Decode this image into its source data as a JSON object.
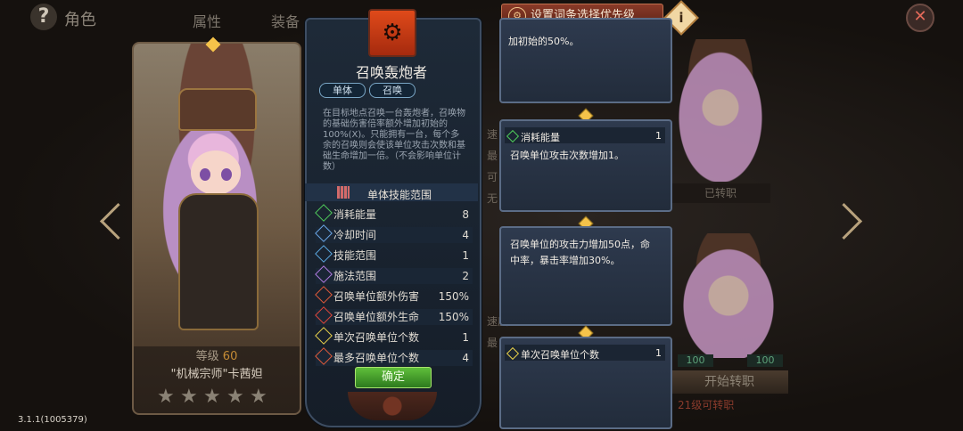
{
  "header": {
    "help_icon": "?",
    "title": "角色",
    "tabs": [
      "属性",
      "装备"
    ],
    "priority_button": "设置词条选择优先级",
    "info_icon": "i",
    "close_icon": "✕"
  },
  "character": {
    "level_label": "等级",
    "level_value": "60",
    "name": "\"机械宗师\"卡茜妲",
    "stars": [
      "★",
      "★",
      "★",
      "★",
      "★"
    ]
  },
  "skill": {
    "name": "召唤轰炮者",
    "tags": [
      "单体",
      "召唤"
    ],
    "description": "在目标地点召唤一台轰炮者，召唤物的基础伤害倍率额外增加初始的100%(X)。只能拥有一台，每个多余的召唤则会使该单位攻击次数和基础生命增加一倍。（不会影响单位计数）",
    "range_label": "单体技能范围",
    "stats": [
      {
        "label": "消耗能量",
        "value": "8",
        "color": "#4ecb5a"
      },
      {
        "label": "冷却时间",
        "value": "4",
        "color": "#6aa7e8"
      },
      {
        "label": "技能范围",
        "value": "1",
        "color": "#5aa6e0"
      },
      {
        "label": "施法范围",
        "value": "2",
        "color": "#b07ae0"
      },
      {
        "label": "召唤单位额外伤害",
        "value": "150%",
        "color": "#e05a3a"
      },
      {
        "label": "召唤单位额外生命",
        "value": "150%",
        "color": "#e0463a"
      },
      {
        "label": "单次召唤单位个数",
        "value": "1",
        "color": "#e8d04a"
      },
      {
        "label": "最多召唤单位个数",
        "value": "4",
        "color": "#e05a3a"
      }
    ],
    "confirm": "确定"
  },
  "affixes": {
    "top_text": "加初始的50%。",
    "energy_title": "消耗能量",
    "energy_value": "1",
    "energy_desc": "召唤单位攻击次数增加1。",
    "attack_desc_1": "召唤单位的攻击力增加50点，命",
    "attack_desc_2": "中率，暴击率增加30%。",
    "summon_title": "单次召唤单位个数",
    "summon_value": "1"
  },
  "right": {
    "turned": "已转职",
    "num_left": "100",
    "num_right": "100",
    "start_button": "开始转职",
    "unlock_text": "21级可转职",
    "side_texts": [
      "速",
      "最",
      "可",
      "无",
      "速度",
      "最"
    ]
  },
  "version": "3.1.1(1005379)"
}
